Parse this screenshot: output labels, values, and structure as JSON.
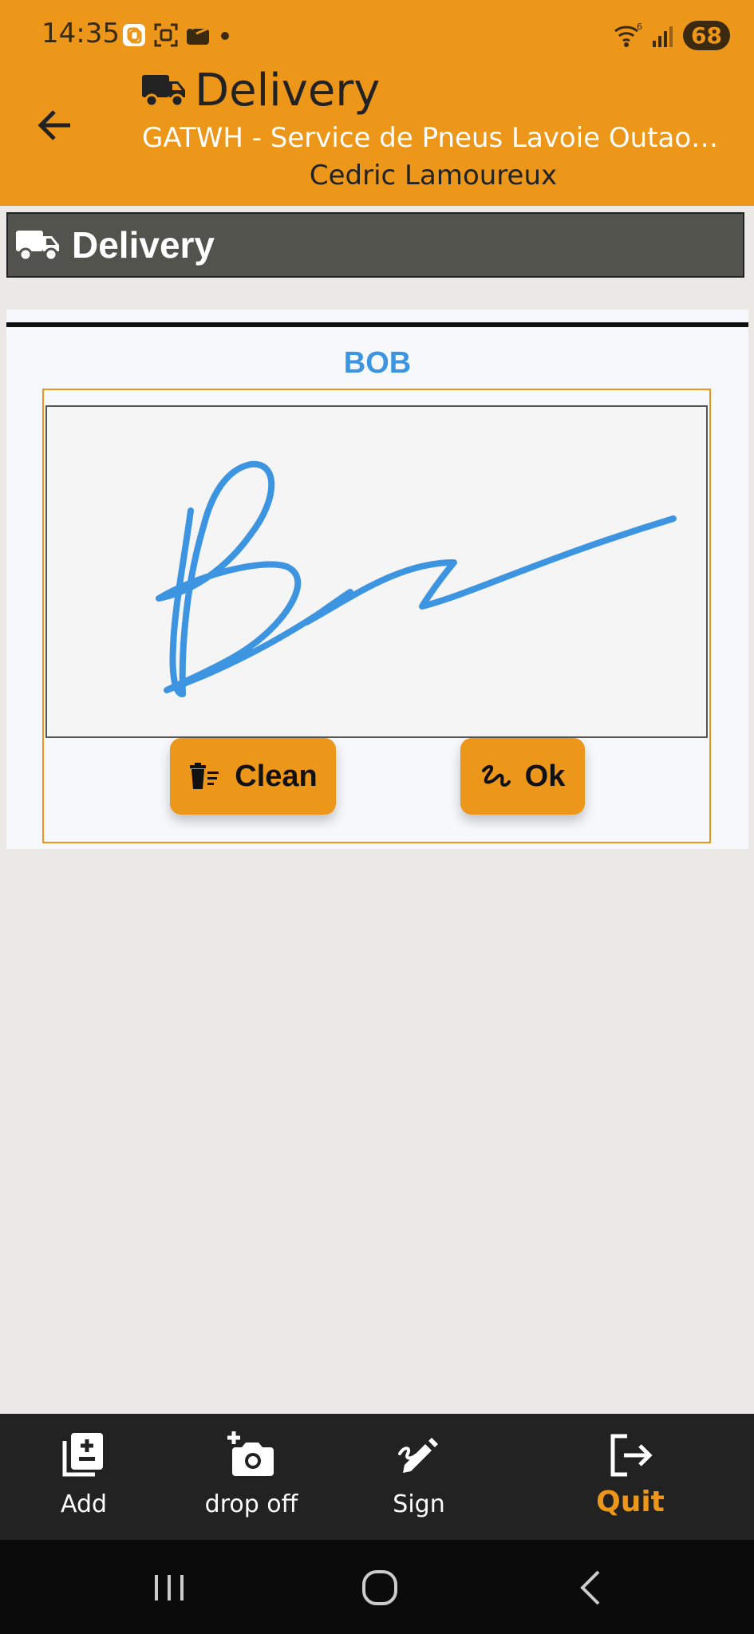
{
  "status_bar": {
    "time": "14:35",
    "battery": "68",
    "network": "6",
    "icons": [
      "sync-icon",
      "scan-icon",
      "app-icon",
      "dot-icon",
      "wifi-icon",
      "signal-icon",
      "battery-icon"
    ]
  },
  "header": {
    "title": "Delivery",
    "subtitle": "GATWH - Service de Pneus Lavoie Outaouais",
    "user": "Cedric Lamoureux",
    "back_icon": "arrow-left-icon",
    "title_icon": "truck-icon"
  },
  "section": {
    "title": "Delivery",
    "icon": "truck-icon"
  },
  "signature": {
    "signer": "BOB",
    "stroke_color": "#3D94E0",
    "clean_label": "Clean",
    "clean_icon": "trash-list-icon",
    "ok_label": "Ok",
    "ok_icon": "signature-icon"
  },
  "bottom_nav": {
    "add": "Add",
    "drop_off": "drop off",
    "sign": "Sign",
    "quit": "Quit"
  },
  "colors": {
    "accent": "#EC9719",
    "section_header": "#53534D",
    "background": "#EAE9E5",
    "nav_background": "#222222"
  }
}
